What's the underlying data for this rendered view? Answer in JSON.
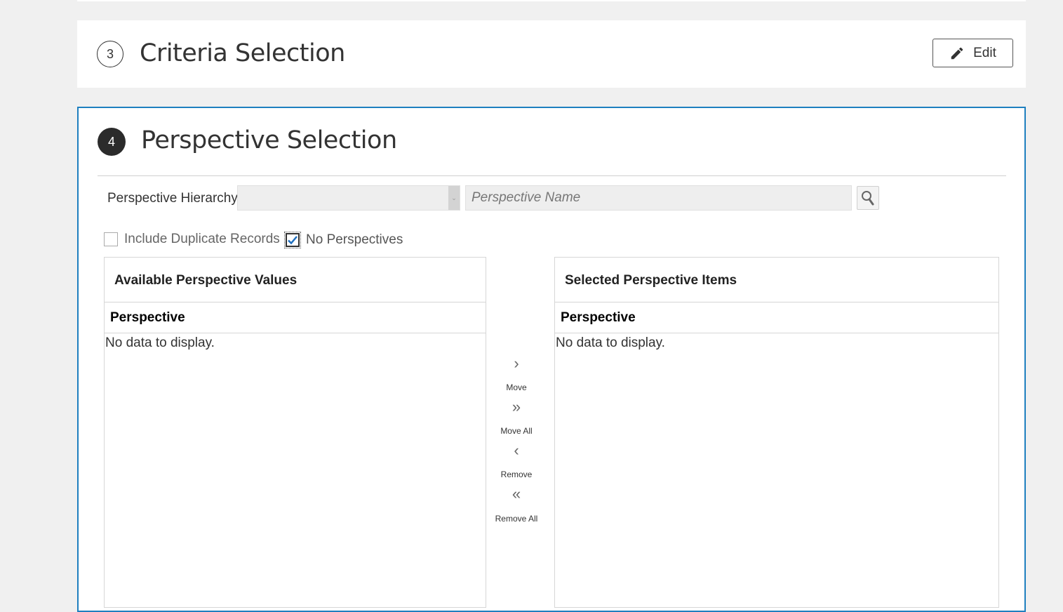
{
  "step3": {
    "number": "3",
    "title": "Criteria Selection",
    "edit_label": "Edit"
  },
  "step4": {
    "number": "4",
    "title": "Perspective Selection",
    "hierarchy_label": "Perspective Hierarchy",
    "hierarchy_value": "",
    "name_placeholder": "Perspective Name",
    "include_duplicates_label": "Include Duplicate Records",
    "include_duplicates_checked": false,
    "no_perspectives_label": "No Perspectives",
    "no_perspectives_checked": true
  },
  "available": {
    "title": "Available Perspective Values",
    "column": "Perspective",
    "empty": "No data to display."
  },
  "selected": {
    "title": "Selected Perspective Items",
    "column": "Perspective",
    "empty": "No data to display."
  },
  "shuttle": {
    "move": {
      "icon": "›",
      "label": "Move"
    },
    "move_all": {
      "icon": "»",
      "label": "Move All"
    },
    "remove": {
      "icon": "‹",
      "label": "Remove"
    },
    "remove_all": {
      "icon": "«",
      "label": "Remove All"
    }
  },
  "colors": {
    "accent_border": "#1e7fbf",
    "step_badge": "#2b2b2b"
  }
}
